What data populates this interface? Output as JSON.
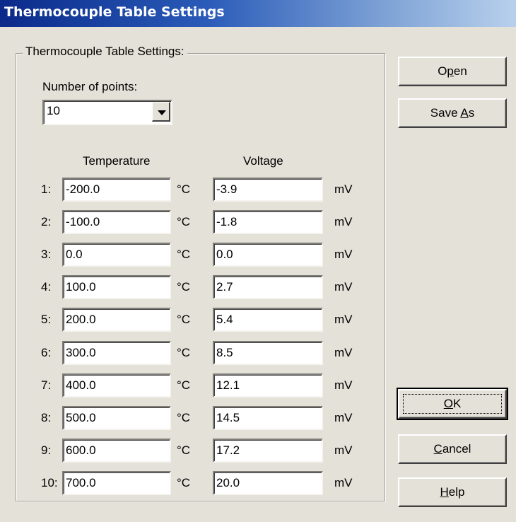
{
  "window": {
    "title": "Thermocouple Table Settings"
  },
  "group": {
    "legend": "Thermocouple Table Settings:"
  },
  "points": {
    "label": "Number of points:",
    "value": "10"
  },
  "columns": {
    "temperature": "Temperature",
    "voltage": "Voltage"
  },
  "units": {
    "temperature": "°C",
    "voltage": "mV"
  },
  "rows": [
    {
      "num": "1:",
      "temp": "-200.0",
      "volt": "-3.9"
    },
    {
      "num": "2:",
      "temp": "-100.0",
      "volt": "-1.8"
    },
    {
      "num": "3:",
      "temp": "0.0",
      "volt": "0.0"
    },
    {
      "num": "4:",
      "temp": "100.0",
      "volt": "2.7"
    },
    {
      "num": "5:",
      "temp": "200.0",
      "volt": "5.4"
    },
    {
      "num": "6:",
      "temp": "300.0",
      "volt": "8.5"
    },
    {
      "num": "7:",
      "temp": "400.0",
      "volt": "12.1"
    },
    {
      "num": "8:",
      "temp": "500.0",
      "volt": "14.5"
    },
    {
      "num": "9:",
      "temp": "600.0",
      "volt": "17.2"
    },
    {
      "num": "10:",
      "temp": "700.0",
      "volt": "20.0"
    }
  ],
  "buttons": {
    "open": "Open",
    "save_as": "Save As",
    "ok": "OK",
    "cancel": "Cancel",
    "help": "Help"
  }
}
